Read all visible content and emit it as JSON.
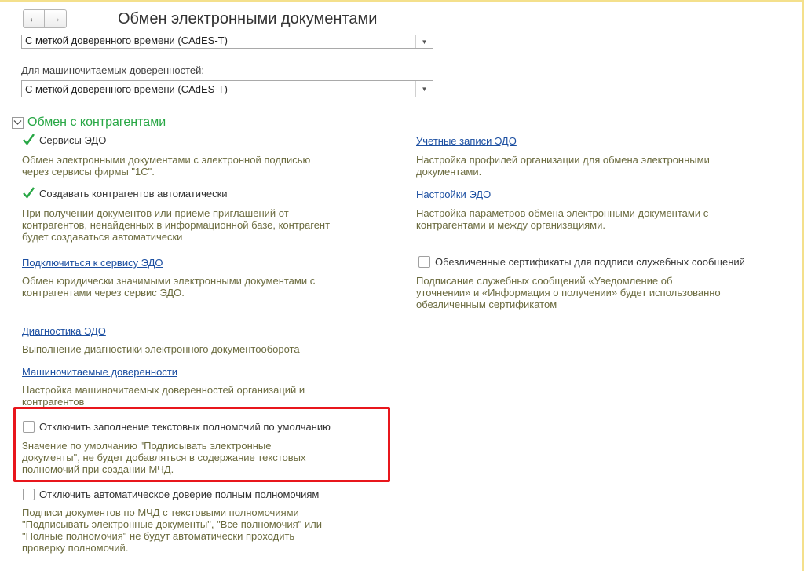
{
  "window": {
    "title": "Обмен электронными документами",
    "nav": {
      "back_label": "←",
      "forward_label": "→"
    }
  },
  "signature_settings": {
    "top_select_value": "С меткой доверенного времени (CAdES-T)",
    "mchd_label": "Для машиночитаемых доверенностей:",
    "mchd_select_value": "С меткой доверенного времени (CAdES-T)",
    "dropdown_arrow": "▼"
  },
  "group": {
    "title": "Обмен с контрагентами",
    "toggle_icon": "chevron-down-icon",
    "check_color": "#28a745"
  },
  "left": {
    "edo_services": {
      "label": "Сервисы ЭДО",
      "checked": true,
      "desc": [
        "Обмен электронными документами с электронной подписью",
        "через сервисы фирмы \"1С\"."
      ]
    },
    "auto_contractors": {
      "label": "Создавать контрагентов автоматически",
      "checked": true,
      "desc": [
        "При получении документов или приеме приглашений от",
        "контрагентов, ненайденных в информационной базе, контрагент",
        "будет создаваться автоматически"
      ]
    },
    "connect_service": {
      "link": "Подключиться к сервису ЭДО",
      "desc": [
        "Обмен юридически значимыми электронными документами с",
        "контрагентами через сервис ЭДО."
      ]
    },
    "diagnostics": {
      "link": "Диагностика ЭДО",
      "desc": [
        "Выполнение диагностики электронного документооборота"
      ]
    },
    "mchd": {
      "link": "Машиночитаемые доверенности",
      "desc": [
        "Настройка машиночитаемых доверенностей организаций и",
        "контрагентов"
      ]
    },
    "disable_text_powers": {
      "label": "Отключить заполнение текстовых полномочий по умолчанию",
      "checked": false,
      "desc": [
        "Значение по умолчанию \"Подписывать электронные",
        "документы\", не будет добавляться в содержание текстовых",
        "полномочий при создании МЧД."
      ]
    },
    "disable_auto_trust": {
      "label": "Отключить автоматическое доверие полным полномочиям",
      "checked": false,
      "desc": [
        "Подписи документов по МЧД с текстовыми полномочиями",
        "\"Подписывать электронные документы\", \"Все полномочия\" или",
        "\"Полные полномочия\" не будут автоматически проходить",
        "проверку полномочий."
      ]
    }
  },
  "right": {
    "accounts": {
      "link": "Учетные записи ЭДО",
      "desc": [
        "Настройка профилей организации для обмена электронными",
        "документами."
      ]
    },
    "settings": {
      "link": "Настройки ЭДО",
      "desc": [
        "Настройка параметров обмена электронными документами с",
        "контрагентами и между организациями."
      ]
    },
    "impersonal_certs": {
      "label": "Обезличенные сертификаты для подписи служебных сообщений",
      "checked": false,
      "desc": [
        "Подписание служебных сообщений «Уведомление об",
        "уточнении» и «Информация о получении» будет использованно",
        "обезличенным сертификатом"
      ]
    }
  },
  "highlight_color": "#e8161c"
}
